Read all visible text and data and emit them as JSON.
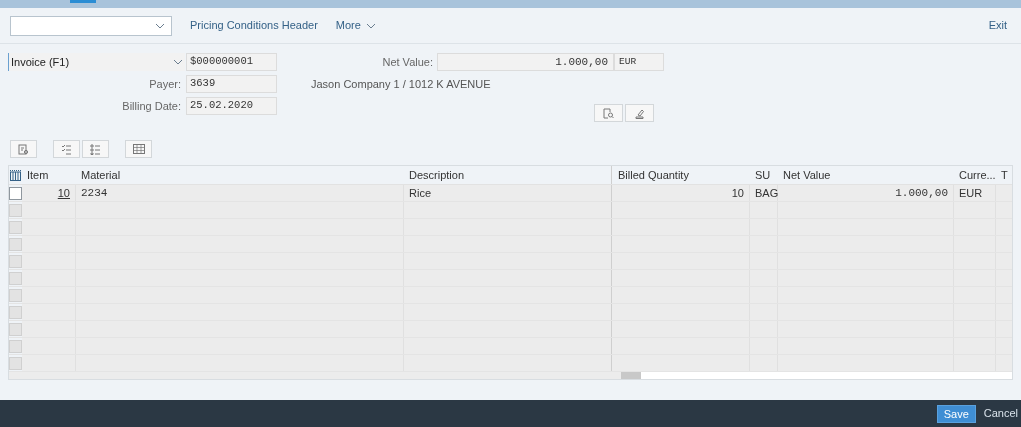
{
  "toolbar": {
    "links": [
      "Pricing Conditions Header"
    ],
    "more": "More",
    "exit": "Exit"
  },
  "header": {
    "doc_type": "Invoice (F1)",
    "doc_number": "$000000001",
    "net_value_label": "Net Value:",
    "net_value": "1.000,00",
    "currency": "EUR",
    "payer_label": "Payer:",
    "payer": "3639",
    "payer_name": "Jason Company 1 / 1012 K AVENUE",
    "billing_date_label": "Billing Date:",
    "billing_date": "25.02.2020"
  },
  "table": {
    "columns": [
      "Item",
      "Material",
      "Description",
      "Billed Quantity",
      "SU",
      "Net Value",
      "Curre...",
      "T"
    ],
    "rows": [
      {
        "selected": false,
        "disabled": false,
        "cells": [
          "10",
          "2234",
          "Rice",
          "10",
          "BAG",
          "1.000,00",
          "EUR"
        ]
      },
      {
        "selected": false,
        "disabled": true
      },
      {
        "selected": false,
        "disabled": true
      },
      {
        "selected": false,
        "disabled": true
      },
      {
        "selected": false,
        "disabled": true
      },
      {
        "selected": false,
        "disabled": true
      },
      {
        "selected": false,
        "disabled": true
      },
      {
        "selected": false,
        "disabled": true
      },
      {
        "selected": false,
        "disabled": true
      },
      {
        "selected": false,
        "disabled": true
      },
      {
        "selected": false,
        "disabled": true
      }
    ]
  },
  "footer": {
    "buttons": [
      {
        "label": "Save",
        "kind": "primary"
      },
      {
        "label": "Cancel",
        "kind": "plain"
      }
    ]
  }
}
